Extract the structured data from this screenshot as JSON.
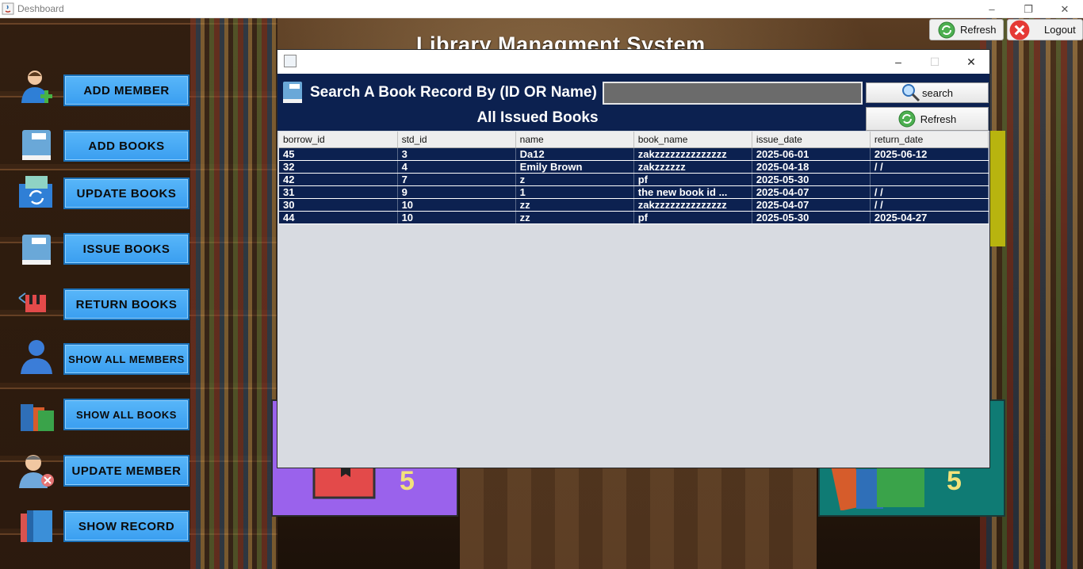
{
  "window": {
    "title": "Deshboard"
  },
  "app": {
    "title": "Library Managment System"
  },
  "top_buttons": {
    "refresh_label": "Refresh",
    "logout_label": "Logout"
  },
  "sidebar": {
    "items": [
      {
        "label": "ADD MEMBER",
        "icon": "add-member-icon"
      },
      {
        "label": "ADD BOOKS",
        "icon": "book-icon"
      },
      {
        "label": "UPDATE BOOKS",
        "icon": "update-books-icon"
      },
      {
        "label": "ISSUE BOOKS",
        "icon": "book-icon"
      },
      {
        "label": "RETURN BOOKS",
        "icon": "return-icon"
      },
      {
        "label": "SHOW ALL MEMBERS",
        "icon": "user-icon"
      },
      {
        "label": "SHOW ALL BOOKS",
        "icon": "books-stack-icon"
      },
      {
        "label": "UPDATE MEMBER",
        "icon": "remove-user-icon"
      },
      {
        "label": "SHOW RECORD",
        "icon": "record-icon"
      }
    ]
  },
  "cards": {
    "left_count": "5",
    "right_count": "5"
  },
  "dialog": {
    "search_label": "Search A Book Record By (ID OR Name)",
    "search_value": "",
    "search_button": "search",
    "title": "All Issued Books",
    "refresh_button": "Refresh",
    "columns": [
      "borrow_id",
      "std_id",
      "name",
      "book_name",
      "issue_date",
      "return_date"
    ],
    "rows": [
      [
        "45",
        "3",
        "Da12",
        "zakzzzzzzzzzzzzzz",
        "2025-06-01",
        "2025-06-12"
      ],
      [
        "32",
        "4",
        "Emily Brown",
        "zakzzzzzz",
        "2025-04-18",
        "/  /"
      ],
      [
        "42",
        "7",
        "z",
        "pf",
        "2025-05-30",
        ""
      ],
      [
        "31",
        "9",
        "1",
        "the new book id ...",
        "2025-04-07",
        "/  /"
      ],
      [
        "30",
        "10",
        "zz",
        "zakzzzzzzzzzzzzzz",
        "2025-04-07",
        "/  /"
      ],
      [
        "44",
        "10",
        "zz",
        "pf",
        "2025-05-30",
        "2025-04-27"
      ]
    ]
  },
  "colors": {
    "header_navy": "#0c2150",
    "button_blue": "#3a9ef0",
    "card_purple": "#9a62ec",
    "card_teal": "#0f7b74"
  }
}
